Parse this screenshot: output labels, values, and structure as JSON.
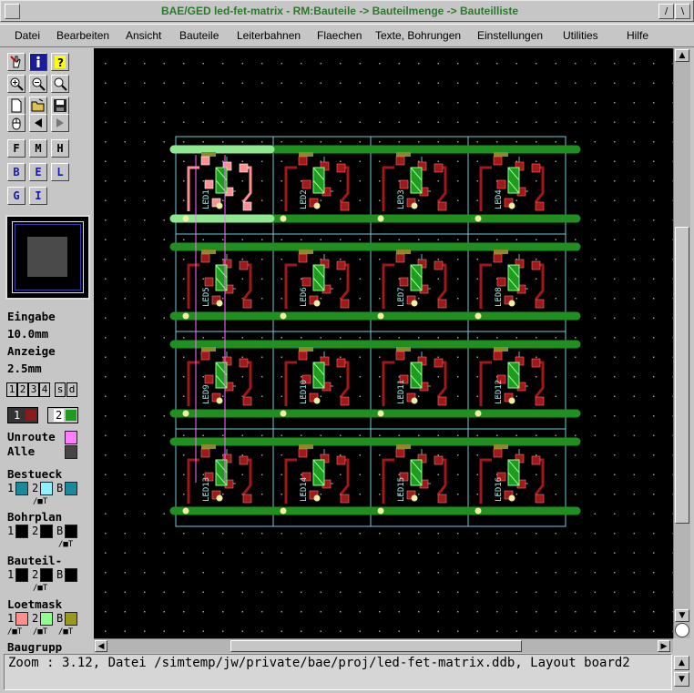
{
  "window": {
    "title": "BAE/GED led-fet-matrix - RM:Bauteile -> Bauteilmenge -> Bauteilliste",
    "left_button": "",
    "right_buttons": [
      "/",
      "\\"
    ]
  },
  "menu": [
    "Datei",
    "Bearbeiten",
    "Ansicht",
    "Bauteile",
    "Leiterbahnen",
    "Flaechen",
    "Texte, Bohrungen",
    "Einstellungen",
    "Utilities",
    "Hilfe"
  ],
  "toolbar": {
    "icons": [
      "select-hand-icon",
      "info-icon",
      "help-icon",
      "zoom-in-icon",
      "zoom-out-icon",
      "zoom-fit-icon",
      "new-file-icon",
      "open-folder-icon",
      "save-disk-icon",
      "mouse-icon",
      "back-arrow-icon",
      "forward-arrow-icon"
    ],
    "letter_buttons": [
      "F",
      "M",
      "H",
      "B",
      "E",
      "L",
      "G",
      "I"
    ]
  },
  "panel": {
    "eingabe_label": "Eingabe",
    "eingabe_value": "10.0mm",
    "anzeige_label": "Anzeige",
    "anzeige_value": "2.5mm",
    "layer_buttons": [
      "1",
      "2",
      "3",
      "4",
      "s",
      "d"
    ],
    "layer1": "1",
    "layer2": "2",
    "unroute_label": "Unroute",
    "alle_label": "Alle",
    "bestueck_label": "Bestueck",
    "bohrplan_label": "Bohrplan",
    "bauteil_label": "Bauteil-",
    "loetmask_label": "Loetmask",
    "baugrupp_label": "Baugrupp",
    "row_numbers": [
      "1",
      "2",
      "B"
    ],
    "row_sub": "/■T",
    "colors": {
      "layer1": "#8b1a1a",
      "layer2": "#1f9b1f",
      "unroute": "#ff7fff",
      "alle": "#444444",
      "bestueck": [
        "#1a8a9a",
        "#8ff0ff",
        "#1a8a9a"
      ],
      "loetmask": [
        "#ff8f8f",
        "#8fff8f",
        "#9a9a1a"
      ]
    }
  },
  "canvas": {
    "board_rows": 4,
    "board_cols": 4,
    "part_labels": [
      "LED1",
      "LED2",
      "LED3",
      "LED4",
      "LED5",
      "LED6",
      "LED7",
      "LED8",
      "LED9",
      "LED10",
      "LED11",
      "LED12",
      "LED13",
      "LED14",
      "LED15",
      "LED16"
    ]
  },
  "status": {
    "text": "Zoom : 3.12, Datei /simtemp/jw/private/bae/proj/led-fet-matrix.ddb, Layout board2"
  }
}
